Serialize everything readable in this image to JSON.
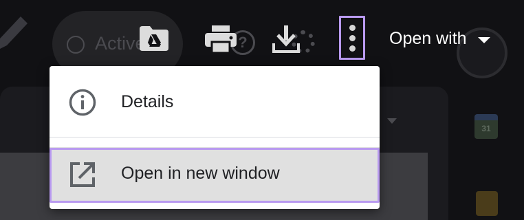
{
  "background": {
    "active_status_label": "Active",
    "calendar_day": "31"
  },
  "toolbar": {
    "icons": [
      "drive-folder-icon",
      "printer-icon",
      "download-icon",
      "more-vert-icon"
    ],
    "open_with_label": "Open with"
  },
  "menu": {
    "items": [
      {
        "label": "Details",
        "icon": "info-icon"
      },
      {
        "label": "Open in new window",
        "icon": "open-in-new-icon"
      }
    ]
  },
  "colors": {
    "highlight_outline": "#b99af0",
    "menu_background": "#ffffff",
    "hover_background": "#e0e0e0",
    "page_background": "#111114"
  }
}
